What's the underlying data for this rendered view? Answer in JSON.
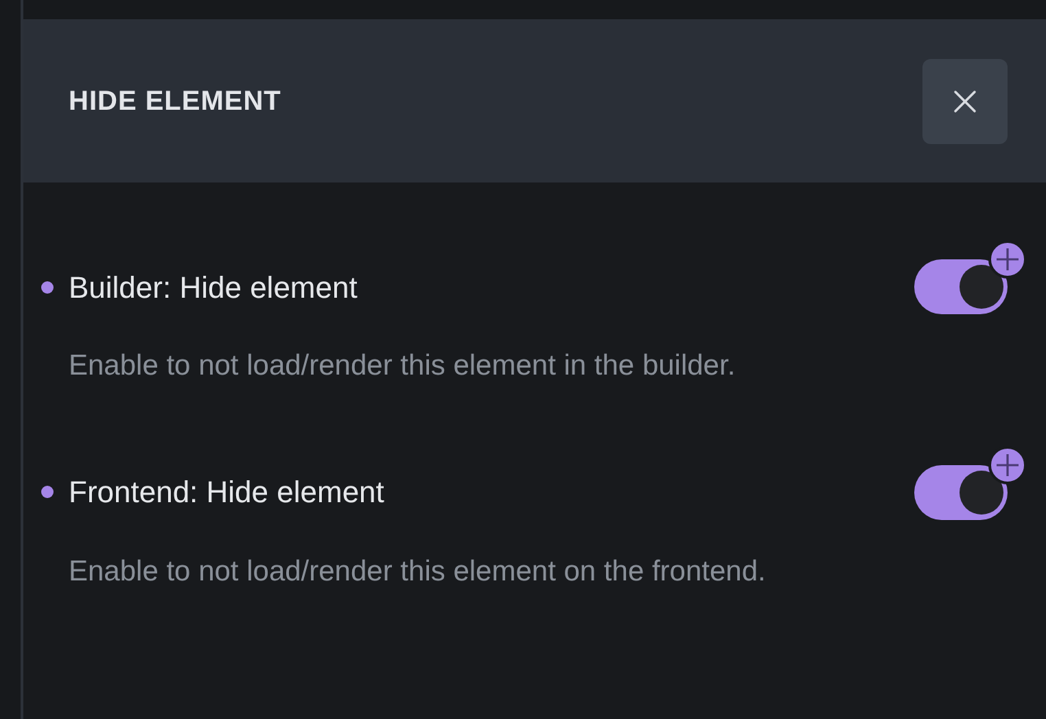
{
  "panel": {
    "title": "HIDE ELEMENT"
  },
  "settings": [
    {
      "label": "Builder: Hide element",
      "description": "Enable to not load/render this element in the builder.",
      "on": true
    },
    {
      "label": "Frontend: Hide element",
      "description": "Enable to not load/render this element on the frontend.",
      "on": true
    }
  ]
}
